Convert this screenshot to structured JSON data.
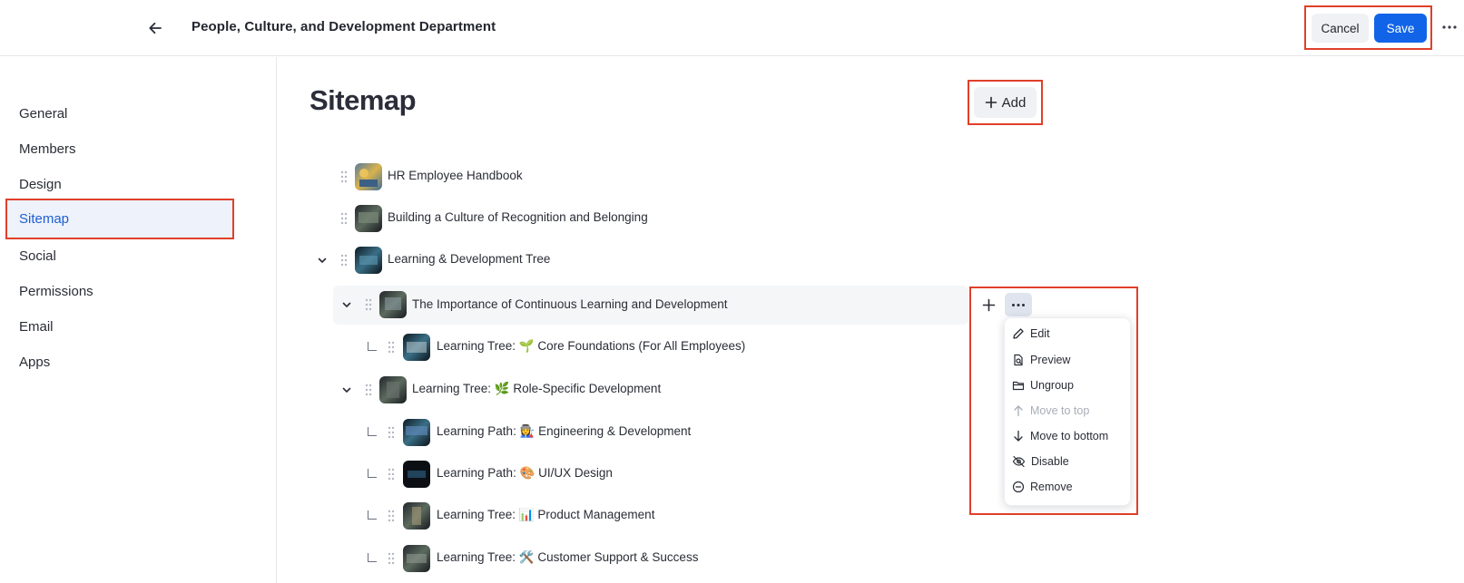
{
  "header": {
    "title": "People, Culture, and Development Department",
    "cancel_label": "Cancel",
    "save_label": "Save"
  },
  "sidebar": {
    "items": [
      {
        "label": "General"
      },
      {
        "label": "Members"
      },
      {
        "label": "Design"
      },
      {
        "label": "Sitemap",
        "active": true
      },
      {
        "label": "Social"
      },
      {
        "label": "Permissions"
      },
      {
        "label": "Email"
      },
      {
        "label": "Apps"
      }
    ]
  },
  "main": {
    "title": "Sitemap",
    "add_label": "Add"
  },
  "tree": [
    {
      "label": "HR Employee Handbook"
    },
    {
      "label": "Building a Culture of Recognition and Belonging"
    },
    {
      "label": "Learning & Development Tree",
      "expanded": true
    },
    {
      "label": "The Importance of Continuous Learning and Development",
      "expanded": true
    },
    {
      "label": "Learning Tree: 🌱 Core Foundations (For All Employees)"
    },
    {
      "label": "Learning Tree: 🌿 Role-Specific Development",
      "expanded": true
    },
    {
      "label": "Learning Path: 👩‍🏭 Engineering & Development"
    },
    {
      "label": "Learning Path: 🎨 UI/UX Design"
    },
    {
      "label": "Learning Tree: 📊 Product Management"
    },
    {
      "label": "Learning Tree: 🛠️ Customer Support & Success"
    }
  ],
  "context_menu": {
    "items": [
      {
        "label": "Edit",
        "icon": "pencil-icon",
        "disabled": false
      },
      {
        "label": "Preview",
        "icon": "preview-icon",
        "disabled": false
      },
      {
        "label": "Ungroup",
        "icon": "folder-open-icon",
        "disabled": false
      },
      {
        "label": "Move to top",
        "icon": "arrow-up-icon",
        "disabled": true
      },
      {
        "label": "Move to bottom",
        "icon": "arrow-down-icon",
        "disabled": false
      },
      {
        "label": "Disable",
        "icon": "eye-off-icon",
        "disabled": false
      },
      {
        "label": "Remove",
        "icon": "minus-circle-icon",
        "disabled": false
      }
    ]
  },
  "colors": {
    "accent": "#1164e8",
    "highlight": "#e0402a",
    "active_bg": "#edf2fb",
    "active_text": "#1d5fd0"
  }
}
